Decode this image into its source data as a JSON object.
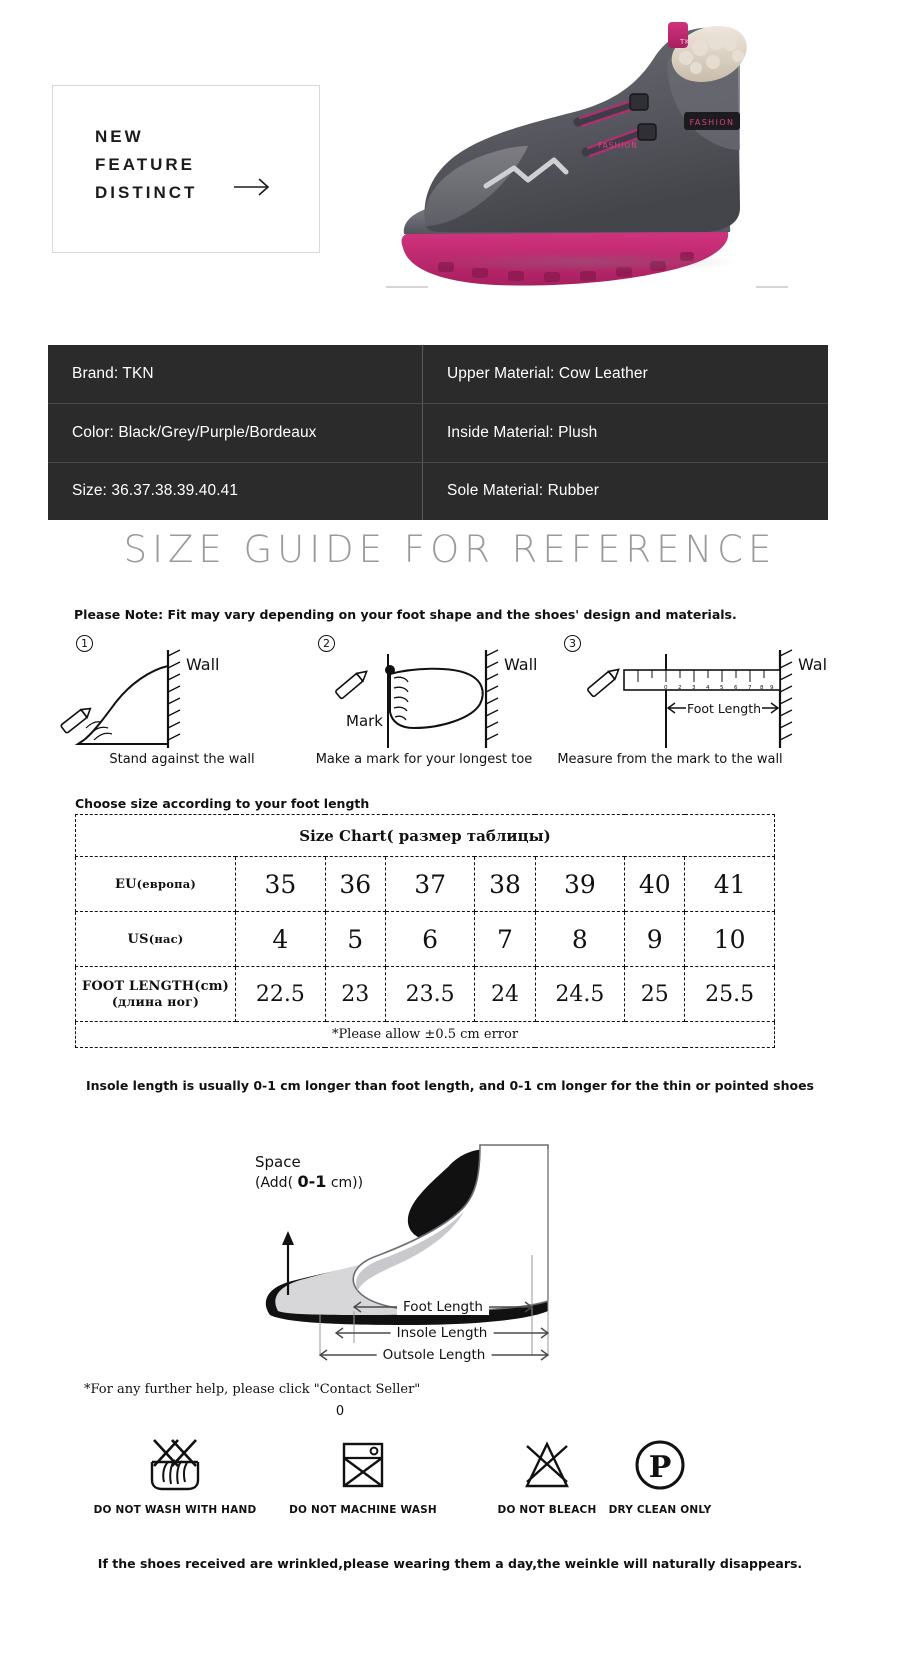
{
  "hero": {
    "line1": "NEW",
    "line2": "FEATURE",
    "line3": "DISTINCT",
    "arrow_icon": "arrow-right-icon",
    "product_icon": "hiking-boot-photo"
  },
  "specs": {
    "rows": [
      {
        "left": "Brand: TKN",
        "right": "Upper  Material:  Cow  Leather"
      },
      {
        "left": "Color: Black/Grey/Purple/Bordeaux",
        "right": "Inside  Material:  Plush"
      },
      {
        "left": "Size: 36.37.38.39.40.41",
        "right": "Sole  Material:  Rubber"
      }
    ],
    "background": "#2b2b2b"
  },
  "size_guide": {
    "title": "SIZE GUIDE FOR REFERENCE",
    "note": "Please Note:  Fit may vary depending on your foot shape and the shoes' design and materials.",
    "steps": [
      {
        "num": "①",
        "wall": "Wall",
        "caption": "Stand against the wall"
      },
      {
        "num": "②",
        "wall": "Wall",
        "mark": "Mark",
        "caption": "Make a mark for your longest toe"
      },
      {
        "num": "③",
        "wall": "Wall",
        "foot_length": "Foot Length",
        "caption": "Measure from the mark to the wall"
      }
    ],
    "choose_line": "Choose size according to your foot length"
  },
  "chart_data": {
    "type": "table",
    "title": "Size Chart( размер таблицы)",
    "rows": [
      {
        "label": "EU",
        "label_sub": "(европа)",
        "values": [
          "35",
          "36",
          "37",
          "38",
          "39",
          "40",
          "41"
        ]
      },
      {
        "label": "US",
        "label_sub": "(нас)",
        "values": [
          "4",
          "5",
          "6",
          "7",
          "8",
          "9",
          "10"
        ]
      },
      {
        "label": "FOOT LENGTH(cm)",
        "label_sub": "(длина ног)",
        "values": [
          "22.5",
          "23",
          "23.5",
          "24",
          "24.5",
          "25",
          "25.5"
        ]
      }
    ],
    "footer": "*Please allow ±0.5 cm error"
  },
  "insole": {
    "note": "Insole length is usually 0-1 cm longer than foot length, and 0-1 cm longer for the thin or pointed shoes",
    "space_line1": "Space",
    "space_line2_pre": "(Add( ",
    "space_line2_bold": "0-1",
    "space_line2_post": " cm))",
    "dims": [
      "Foot Length",
      "Insole Length",
      "Outsole Length"
    ]
  },
  "footer": {
    "contact": "*For any further help, please click \"Contact Seller\"",
    "zero": "0",
    "care": [
      {
        "icon": "do-not-hand-wash-icon",
        "label": "DO NOT WASH WITH HAND"
      },
      {
        "icon": "do-not-machine-wash-icon",
        "label": "DO NOT MACHINE WASH"
      },
      {
        "icon": "do-not-bleach-icon",
        "label": "DO NOT BLEACH"
      },
      {
        "icon": "dry-clean-only-icon",
        "label": "DRY CLEAN ONLY"
      }
    ],
    "bottom_note": "If the shoes received are wrinkled,please wearing them a day,the weinkle will naturally disappears."
  }
}
